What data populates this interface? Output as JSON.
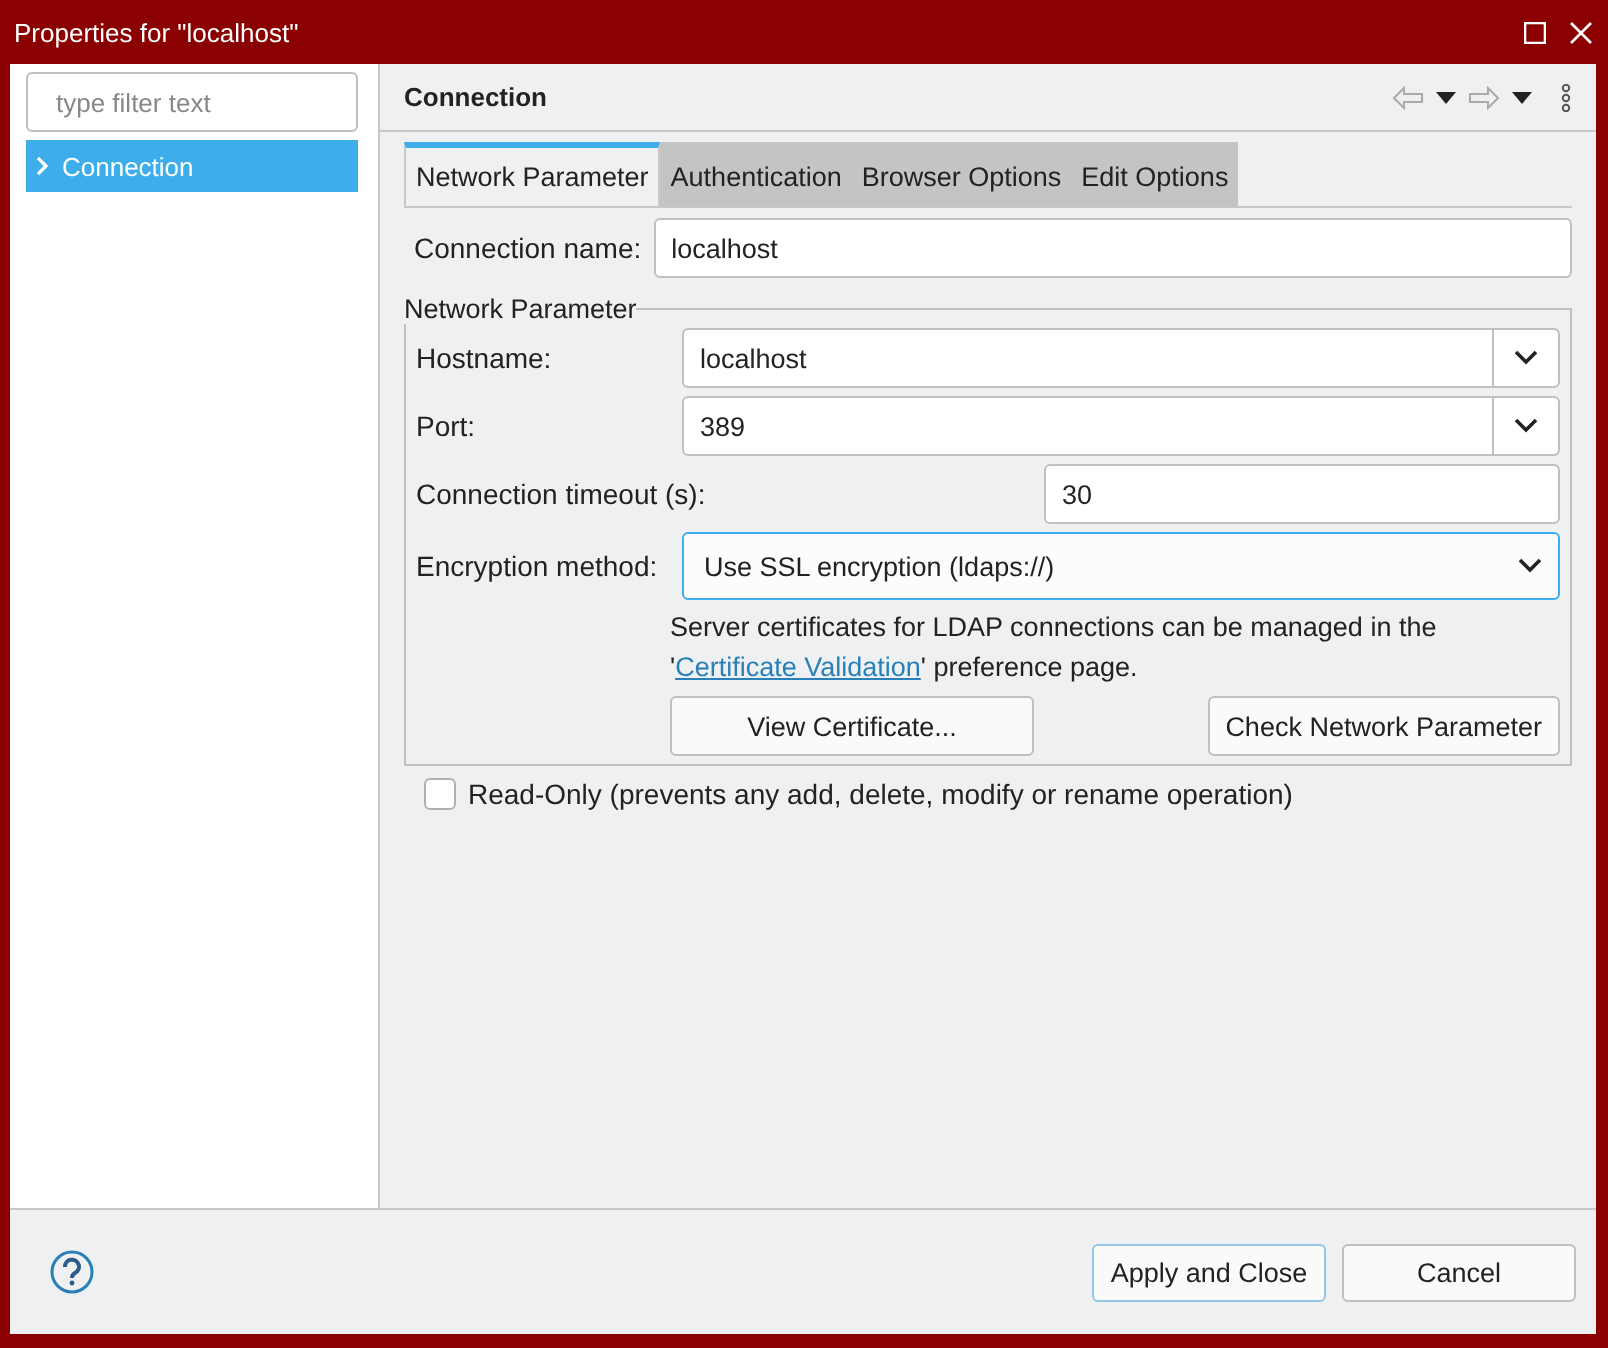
{
  "window": {
    "title": "Properties for \"localhost\""
  },
  "filter": {
    "placeholder": "type filter text"
  },
  "tree": [
    {
      "label": "Connection",
      "selected": true,
      "expanded": false
    }
  ],
  "page": {
    "title": "Connection"
  },
  "tabs": [
    {
      "label": "Network Parameter",
      "selected": true
    },
    {
      "label": "Authentication",
      "selected": false
    },
    {
      "label": "Browser Options",
      "selected": false
    },
    {
      "label": "Edit Options",
      "selected": false
    }
  ],
  "connection_name": {
    "label": "Connection name:",
    "value": "localhost"
  },
  "group": {
    "title": "Network Parameter",
    "fields": [
      {
        "kind": "combo",
        "label": "Hostname:",
        "value": "localhost"
      },
      {
        "kind": "combo",
        "label": "Port:",
        "value": "389"
      },
      {
        "kind": "text",
        "label": "Connection timeout (s):",
        "value": "30"
      },
      {
        "kind": "select",
        "label": "Encryption method:",
        "value": "Use SSL encryption (ldaps://)"
      }
    ],
    "note": {
      "before": "Server certificates for LDAP connections can be managed in the '",
      "link": "Certificate Validation",
      "after": "' preference page."
    },
    "buttons": [
      "View Certificate...",
      "Check Network Parameter"
    ]
  },
  "read_only": {
    "label": "Read-Only (prevents any add, delete, modify or rename operation)",
    "checked": false
  },
  "footer": {
    "buttons": [
      {
        "label": "Apply and Close",
        "default": true
      },
      {
        "label": "Cancel",
        "default": false
      }
    ]
  }
}
